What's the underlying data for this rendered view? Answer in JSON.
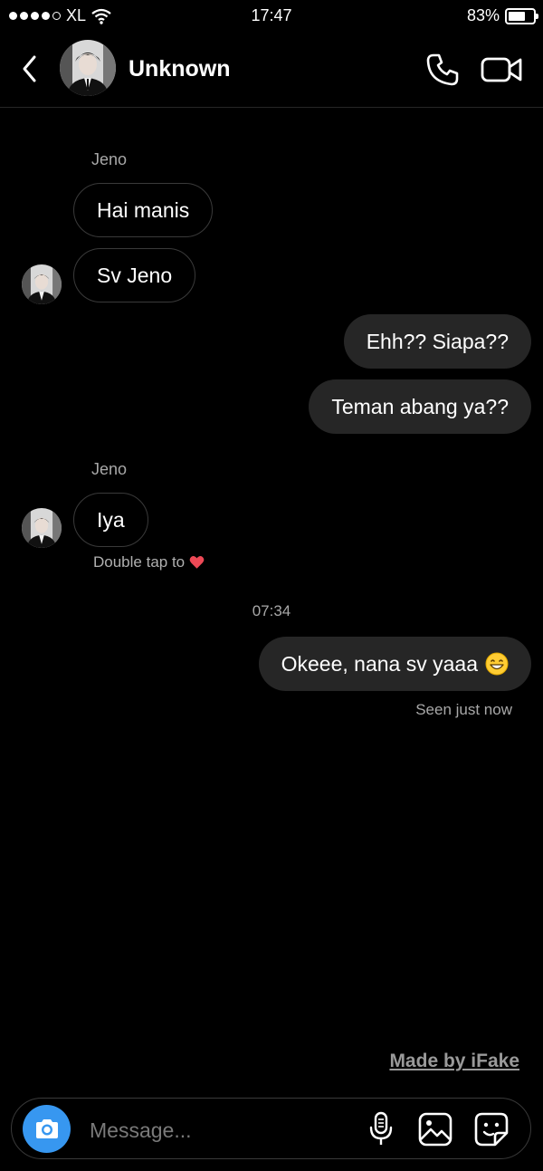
{
  "status_bar": {
    "carrier": "XL",
    "time": "17:47",
    "battery_percent": "83%",
    "battery_level": 0.83,
    "signal_bars": 4
  },
  "header": {
    "title": "Unknown",
    "back_icon": "chevron-left-icon",
    "call_icon": "phone-icon",
    "video_icon": "video-camera-icon"
  },
  "messages": [
    {
      "sender": "Jeno",
      "text": "Hai manis",
      "direction": "incoming"
    },
    {
      "text": "Sv Jeno",
      "direction": "incoming"
    },
    {
      "text": "Ehh?? Siapa??",
      "direction": "outgoing"
    },
    {
      "text": "Teman abang ya??",
      "direction": "outgoing"
    },
    {
      "sender": "Jeno",
      "text": "Iya",
      "direction": "incoming",
      "hint": "Double tap to"
    },
    {
      "timestamp": "07:34",
      "text": "Okeee, nana sv yaaa",
      "direction": "outgoing",
      "emoji": "grinning-face",
      "status": "Seen just now"
    }
  ],
  "watermark": "Made by iFake",
  "composer": {
    "placeholder": "Message...",
    "icons": [
      "camera-icon",
      "microphone-icon",
      "gallery-icon",
      "sticker-icon"
    ]
  },
  "colors": {
    "background": "#000000",
    "outgoing_bubble": "#262626",
    "incoming_border": "#3a3a3a",
    "camera_button": "#3797f0",
    "secondary_text": "#a8a8a8",
    "heart": "#ed4956"
  }
}
